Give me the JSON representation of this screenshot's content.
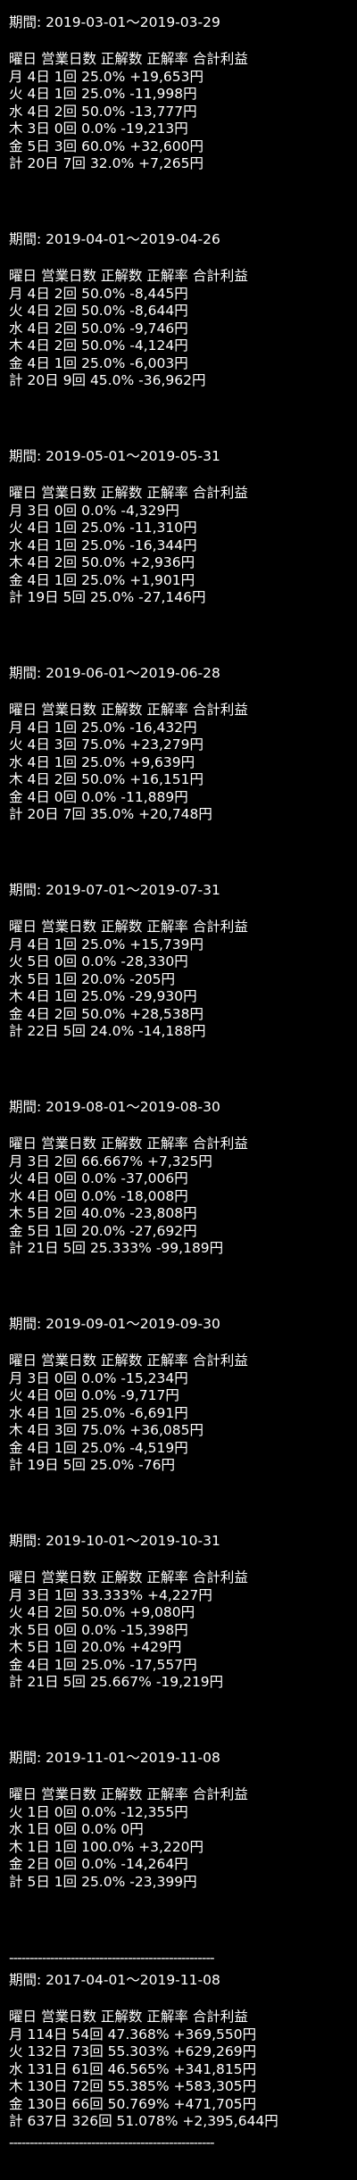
{
  "period_label": "期間: ",
  "header_cols": [
    "曜日",
    "営業日数",
    "正解数",
    "正解率",
    "合計利益"
  ],
  "blocks": [
    {
      "period": "2019-03-01～2019-03-29",
      "rows": [
        [
          "月",
          "4日",
          "1回",
          "25.0%",
          "+19,653円"
        ],
        [
          "火",
          "4日",
          "1回",
          "25.0%",
          "-11,998円"
        ],
        [
          "水",
          "4日",
          "2回",
          "50.0%",
          "-13,777円"
        ],
        [
          "木",
          "3日",
          "0回",
          "0.0%",
          "-19,213円"
        ],
        [
          "金",
          "5日",
          "3回",
          "60.0%",
          "+32,600円"
        ],
        [
          "計",
          "20日",
          "7回",
          "32.0%",
          "+7,265円"
        ]
      ]
    },
    {
      "period": "2019-04-01～2019-04-26",
      "rows": [
        [
          "月",
          "4日",
          "2回",
          "50.0%",
          "-8,445円"
        ],
        [
          "火",
          "4日",
          "2回",
          "50.0%",
          "-8,644円"
        ],
        [
          "水",
          "4日",
          "2回",
          "50.0%",
          "-9,746円"
        ],
        [
          "木",
          "4日",
          "2回",
          "50.0%",
          "-4,124円"
        ],
        [
          "金",
          "4日",
          "1回",
          "25.0%",
          "-6,003円"
        ],
        [
          "計",
          "20日",
          "9回",
          "45.0%",
          "-36,962円"
        ]
      ]
    },
    {
      "period": "2019-05-01～2019-05-31",
      "rows": [
        [
          "月",
          "3日",
          "0回",
          "0.0%",
          "-4,329円"
        ],
        [
          "火",
          "4日",
          "1回",
          "25.0%",
          "-11,310円"
        ],
        [
          "水",
          "4日",
          "1回",
          "25.0%",
          "-16,344円"
        ],
        [
          "木",
          "4日",
          "2回",
          "50.0%",
          "+2,936円"
        ],
        [
          "金",
          "4日",
          "1回",
          "25.0%",
          "+1,901円"
        ],
        [
          "計",
          "19日",
          "5回",
          "25.0%",
          "-27,146円"
        ]
      ]
    },
    {
      "period": "2019-06-01～2019-06-28",
      "rows": [
        [
          "月",
          "4日",
          "1回",
          "25.0%",
          "-16,432円"
        ],
        [
          "火",
          "4日",
          "3回",
          "75.0%",
          "+23,279円"
        ],
        [
          "水",
          "4日",
          "1回",
          "25.0%",
          "+9,639円"
        ],
        [
          "木",
          "4日",
          "2回",
          "50.0%",
          "+16,151円"
        ],
        [
          "金",
          "4日",
          "0回",
          "0.0%",
          "-11,889円"
        ],
        [
          "計",
          "20日",
          "7回",
          "35.0%",
          "+20,748円"
        ]
      ]
    },
    {
      "period": "2019-07-01～2019-07-31",
      "rows": [
        [
          "月",
          "4日",
          "1回",
          "25.0%",
          "+15,739円"
        ],
        [
          "火",
          "5日",
          "0回",
          "0.0%",
          "-28,330円"
        ],
        [
          "水",
          "5日",
          "1回",
          "20.0%",
          "-205円"
        ],
        [
          "木",
          "4日",
          "1回",
          "25.0%",
          "-29,930円"
        ],
        [
          "金",
          "4日",
          "2回",
          "50.0%",
          "+28,538円"
        ],
        [
          "計",
          "22日",
          "5回",
          "24.0%",
          "-14,188円"
        ]
      ]
    },
    {
      "period": "2019-08-01～2019-08-30",
      "rows": [
        [
          "月",
          "3日",
          "2回",
          "66.667%",
          "+7,325円"
        ],
        [
          "火",
          "4日",
          "0回",
          "0.0%",
          "-37,006円"
        ],
        [
          "水",
          "4日",
          "0回",
          "0.0%",
          "-18,008円"
        ],
        [
          "木",
          "5日",
          "2回",
          "40.0%",
          "-23,808円"
        ],
        [
          "金",
          "5日",
          "1回",
          "20.0%",
          "-27,692円"
        ],
        [
          "計",
          "21日",
          "5回",
          "25.333%",
          "-99,189円"
        ]
      ]
    },
    {
      "period": "2019-09-01～2019-09-30",
      "rows": [
        [
          "月",
          "3日",
          "0回",
          "0.0%",
          "-15,234円"
        ],
        [
          "火",
          "4日",
          "0回",
          "0.0%",
          "-9,717円"
        ],
        [
          "水",
          "4日",
          "1回",
          "25.0%",
          "-6,691円"
        ],
        [
          "木",
          "4日",
          "3回",
          "75.0%",
          "+36,085円"
        ],
        [
          "金",
          "4日",
          "1回",
          "25.0%",
          "-4,519円"
        ],
        [
          "計",
          "19日",
          "5回",
          "25.0%",
          "-76円"
        ]
      ]
    },
    {
      "period": "2019-10-01～2019-10-31",
      "rows": [
        [
          "月",
          "3日",
          "1回",
          "33.333%",
          "+4,227円"
        ],
        [
          "火",
          "4日",
          "2回",
          "50.0%",
          "+9,080円"
        ],
        [
          "水",
          "5日",
          "0回",
          "0.0%",
          "-15,398円"
        ],
        [
          "木",
          "5日",
          "1回",
          "20.0%",
          "+429円"
        ],
        [
          "金",
          "4日",
          "1回",
          "25.0%",
          "-17,557円"
        ],
        [
          "計",
          "21日",
          "5回",
          "25.667%",
          "-19,219円"
        ]
      ]
    },
    {
      "period": "2019-11-01～2019-11-08",
      "rows": [
        [
          "火",
          "1日",
          "0回",
          "0.0%",
          "-12,355円"
        ],
        [
          "水",
          "1日",
          "0回",
          "0.0%",
          "0円"
        ],
        [
          "木",
          "1日",
          "1回",
          "100.0%",
          "+3,220円"
        ],
        [
          "金",
          "2日",
          "0回",
          "0.0%",
          "-14,264円"
        ],
        [
          "計",
          "5日",
          "1回",
          "25.0%",
          "-23,399円"
        ]
      ]
    }
  ],
  "divider": "--------------------------------------------------",
  "total": {
    "period": "2017-04-01～2019-11-08",
    "rows": [
      [
        "月",
        "114日",
        "54回",
        "47.368%",
        "+369,550円"
      ],
      [
        "火",
        "132日",
        "73回",
        "55.303%",
        "+629,269円"
      ],
      [
        "水",
        "131日",
        "61回",
        "46.565%",
        "+341,815円"
      ],
      [
        "木",
        "130日",
        "72回",
        "55.385%",
        "+583,305円"
      ],
      [
        "金",
        "130日",
        "66回",
        "50.769%",
        "+471,705円"
      ],
      [
        "計",
        "637日",
        "326回",
        "51.078%",
        "+2,395,644円"
      ]
    ]
  }
}
